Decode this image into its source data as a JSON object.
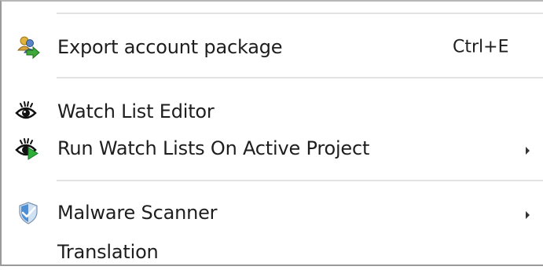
{
  "menu": {
    "items": [
      {
        "label": "Export account package",
        "shortcut": "Ctrl+E",
        "icon": "export-package-icon"
      },
      {
        "label": "Watch List Editor",
        "icon": "eye-icon"
      },
      {
        "label": "Run Watch Lists On Active Project",
        "icon": "eye-run-icon",
        "has_submenu": true
      },
      {
        "label": "Malware Scanner",
        "icon": "shield-icon",
        "has_submenu": true
      },
      {
        "label": "Translation"
      }
    ]
  }
}
